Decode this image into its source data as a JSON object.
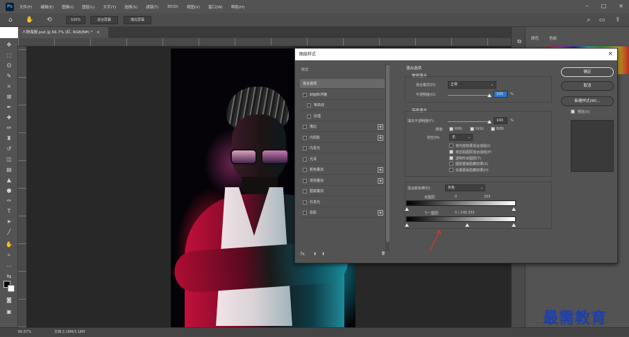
{
  "app": {
    "logo_text": "Ps"
  },
  "menubar": {
    "items": [
      "文件(F)",
      "编辑(E)",
      "图像(I)",
      "图层(L)",
      "文字(Y)",
      "选择(S)",
      "滤镜(T)",
      "3D(D)",
      "视图(V)",
      "窗口(W)",
      "帮助(H)"
    ]
  },
  "options": {
    "zoom": "100%",
    "fit_screen": "适合屏幕",
    "fill_screen": "填充屏幕"
  },
  "document": {
    "tab": "人物海报.psd @ 66.7% (红, RGB/8#) *",
    "tab_close": "×"
  },
  "panels": {
    "tab1": "颜色",
    "tab2": "色板"
  },
  "statusbar": {
    "zoom": "66.67%",
    "doc": "文档:3.18M/3.18M"
  },
  "dialog": {
    "title": "图层样式",
    "close": "×",
    "list_header": "样式",
    "styles": [
      {
        "label": "混合选项",
        "checkbox": false,
        "plus": false,
        "selected": true
      },
      {
        "label": "斜面和浮雕",
        "checkbox": true,
        "plus": false,
        "selected": false
      },
      {
        "label": "等高线",
        "checkbox": true,
        "plus": false,
        "selected": false,
        "indent": true
      },
      {
        "label": "纹理",
        "checkbox": true,
        "plus": false,
        "selected": false,
        "indent": true
      },
      {
        "label": "描边",
        "checkbox": true,
        "plus": true,
        "selected": false
      },
      {
        "label": "内阴影",
        "checkbox": true,
        "plus": true,
        "selected": false
      },
      {
        "label": "内发光",
        "checkbox": true,
        "plus": false,
        "selected": false
      },
      {
        "label": "光泽",
        "checkbox": true,
        "plus": false,
        "selected": false
      },
      {
        "label": "颜色叠加",
        "checkbox": true,
        "plus": true,
        "selected": false
      },
      {
        "label": "渐变叠加",
        "checkbox": true,
        "plus": true,
        "selected": false
      },
      {
        "label": "图案叠加",
        "checkbox": true,
        "plus": false,
        "selected": false
      },
      {
        "label": "外发光",
        "checkbox": true,
        "plus": false,
        "selected": false
      },
      {
        "label": "投影",
        "checkbox": true,
        "plus": true,
        "selected": false
      }
    ],
    "footer": {
      "fx": "fx.",
      "up": "⬆",
      "down": "⬇",
      "trash": "🗑"
    },
    "blend": {
      "section_title": "混合选项",
      "general_title": "常规混合",
      "blend_mode_label": "混合模式(D):",
      "blend_mode_value": "正常",
      "opacity_label": "不透明度(O):",
      "opacity_value": "100",
      "percent": "%",
      "advanced_title": "高级混合",
      "fill_label": "填充不透明度(F):",
      "fill_value": "100",
      "channels_label": "通道:",
      "ch_r": "R(R)",
      "ch_g": "G(G)",
      "ch_b": "B(B)",
      "knockout_label": "挖空(N):",
      "knockout_value": "无",
      "options": [
        {
          "label": "将内部效果混合成组(I)",
          "checked": false
        },
        {
          "label": "将剪贴图层混合成组(P)",
          "checked": true
        },
        {
          "label": "透明形状图层(T)",
          "checked": true
        },
        {
          "label": "图层蒙版隐藏效果(S)",
          "checked": false
        },
        {
          "label": "矢量蒙版隐藏效果(H)",
          "checked": false
        }
      ],
      "blend_if_label": "混合颜色带(E):",
      "blend_if_value": "灰色",
      "this_layer_label": "本图层:",
      "this_layer_min": "0",
      "this_layer_max": "255",
      "under_layer_label": "下一图层:",
      "under_layer_values": "0  /  140    255"
    },
    "buttons": {
      "ok": "确定",
      "cancel": "取消",
      "new_style": "新建样式(W)...",
      "preview": "预览(V)"
    }
  },
  "watermark": "最需教育"
}
